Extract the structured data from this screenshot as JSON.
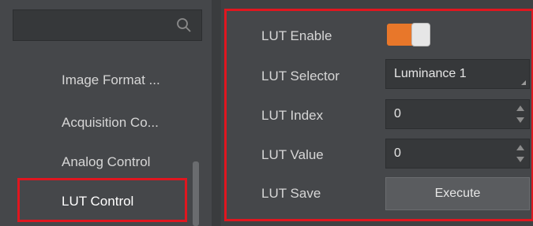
{
  "sidebar": {
    "search": {
      "placeholder": "",
      "icon": "search-icon"
    },
    "items": [
      {
        "label": "Image Format ..."
      },
      {
        "label": "Acquisition Co..."
      },
      {
        "label": "Analog Control"
      },
      {
        "label": "LUT Control",
        "selected": true
      }
    ]
  },
  "properties": {
    "lut_enable": {
      "label": "LUT Enable",
      "on": true
    },
    "lut_selector": {
      "label": "LUT Selector",
      "value": "Luminance 1"
    },
    "lut_index": {
      "label": "LUT Index",
      "value": "0"
    },
    "lut_value": {
      "label": "LUT Value",
      "value": "0"
    },
    "lut_save": {
      "label": "LUT Save",
      "button_label": "Execute"
    }
  },
  "colors": {
    "highlight": "#e0161f",
    "toggle_on": "#e8772a",
    "background": "#45474a"
  }
}
